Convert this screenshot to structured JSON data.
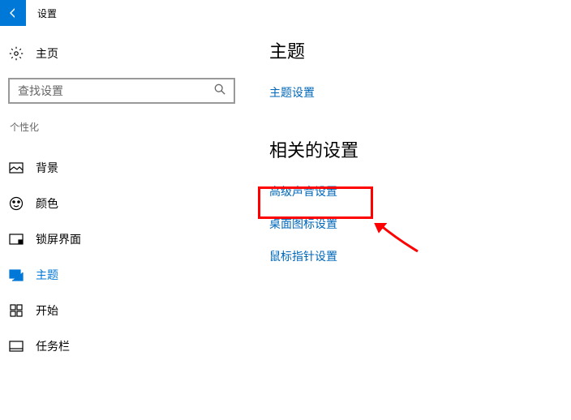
{
  "header": {
    "title": "设置"
  },
  "sidebar": {
    "home_label": "主页",
    "search_placeholder": "查找设置",
    "category_label": "个性化",
    "items": [
      {
        "label": "背景"
      },
      {
        "label": "颜色"
      },
      {
        "label": "锁屏界面"
      },
      {
        "label": "主题"
      },
      {
        "label": "开始"
      },
      {
        "label": "任务栏"
      }
    ]
  },
  "main": {
    "section1_title": "主题",
    "section1_links": [
      "主题设置"
    ],
    "section2_title": "相关的设置",
    "section2_links": [
      "高级声音设置",
      "桌面图标设置",
      "鼠标指针设置"
    ]
  }
}
